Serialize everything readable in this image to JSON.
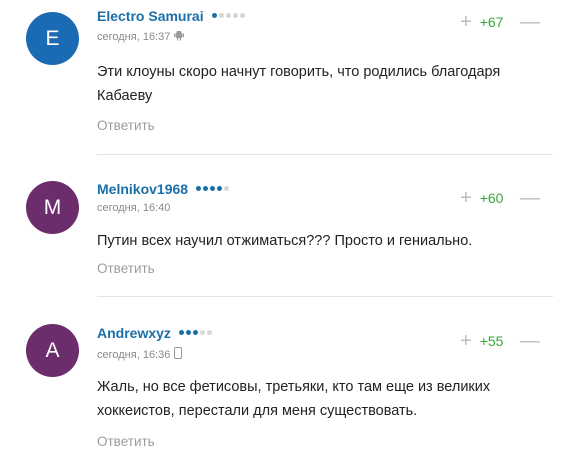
{
  "comments": [
    {
      "avatar_letter": "E",
      "avatar_color": "#1a6bb3",
      "author": "Electro Samurai",
      "rank_level": 1,
      "timestamp": "сегодня, 16:37",
      "device_icon": "android-icon",
      "score": "+67",
      "text": "Эти клоуны скоро начнут говорить, что родились благодаря Кабаеву",
      "reply_label": "Ответить"
    },
    {
      "avatar_letter": "M",
      "avatar_color": "#6b2d6b",
      "author": "Melnikov1968",
      "rank_level": 4,
      "timestamp": "сегодня, 16:40",
      "device_icon": "",
      "score": "+60",
      "text": "Путин всех научил отжиматься??? Просто и гениально.",
      "reply_label": "Ответить"
    },
    {
      "avatar_letter": "A",
      "avatar_color": "#6b2d6b",
      "author": "Andrewxyz",
      "rank_level": 3,
      "timestamp": "сегодня, 16:36",
      "device_icon": "mobile-phone-icon",
      "score": "+55",
      "text": "Жаль, но все фетисовы, третьяки, кто там еще из великих хоккеистов, перестали для меня существовать.",
      "reply_label": "Ответить"
    }
  ],
  "colors": {
    "author": "#1b6fa8",
    "score_positive": "#3aa63a",
    "muted": "#8a8a8a"
  }
}
